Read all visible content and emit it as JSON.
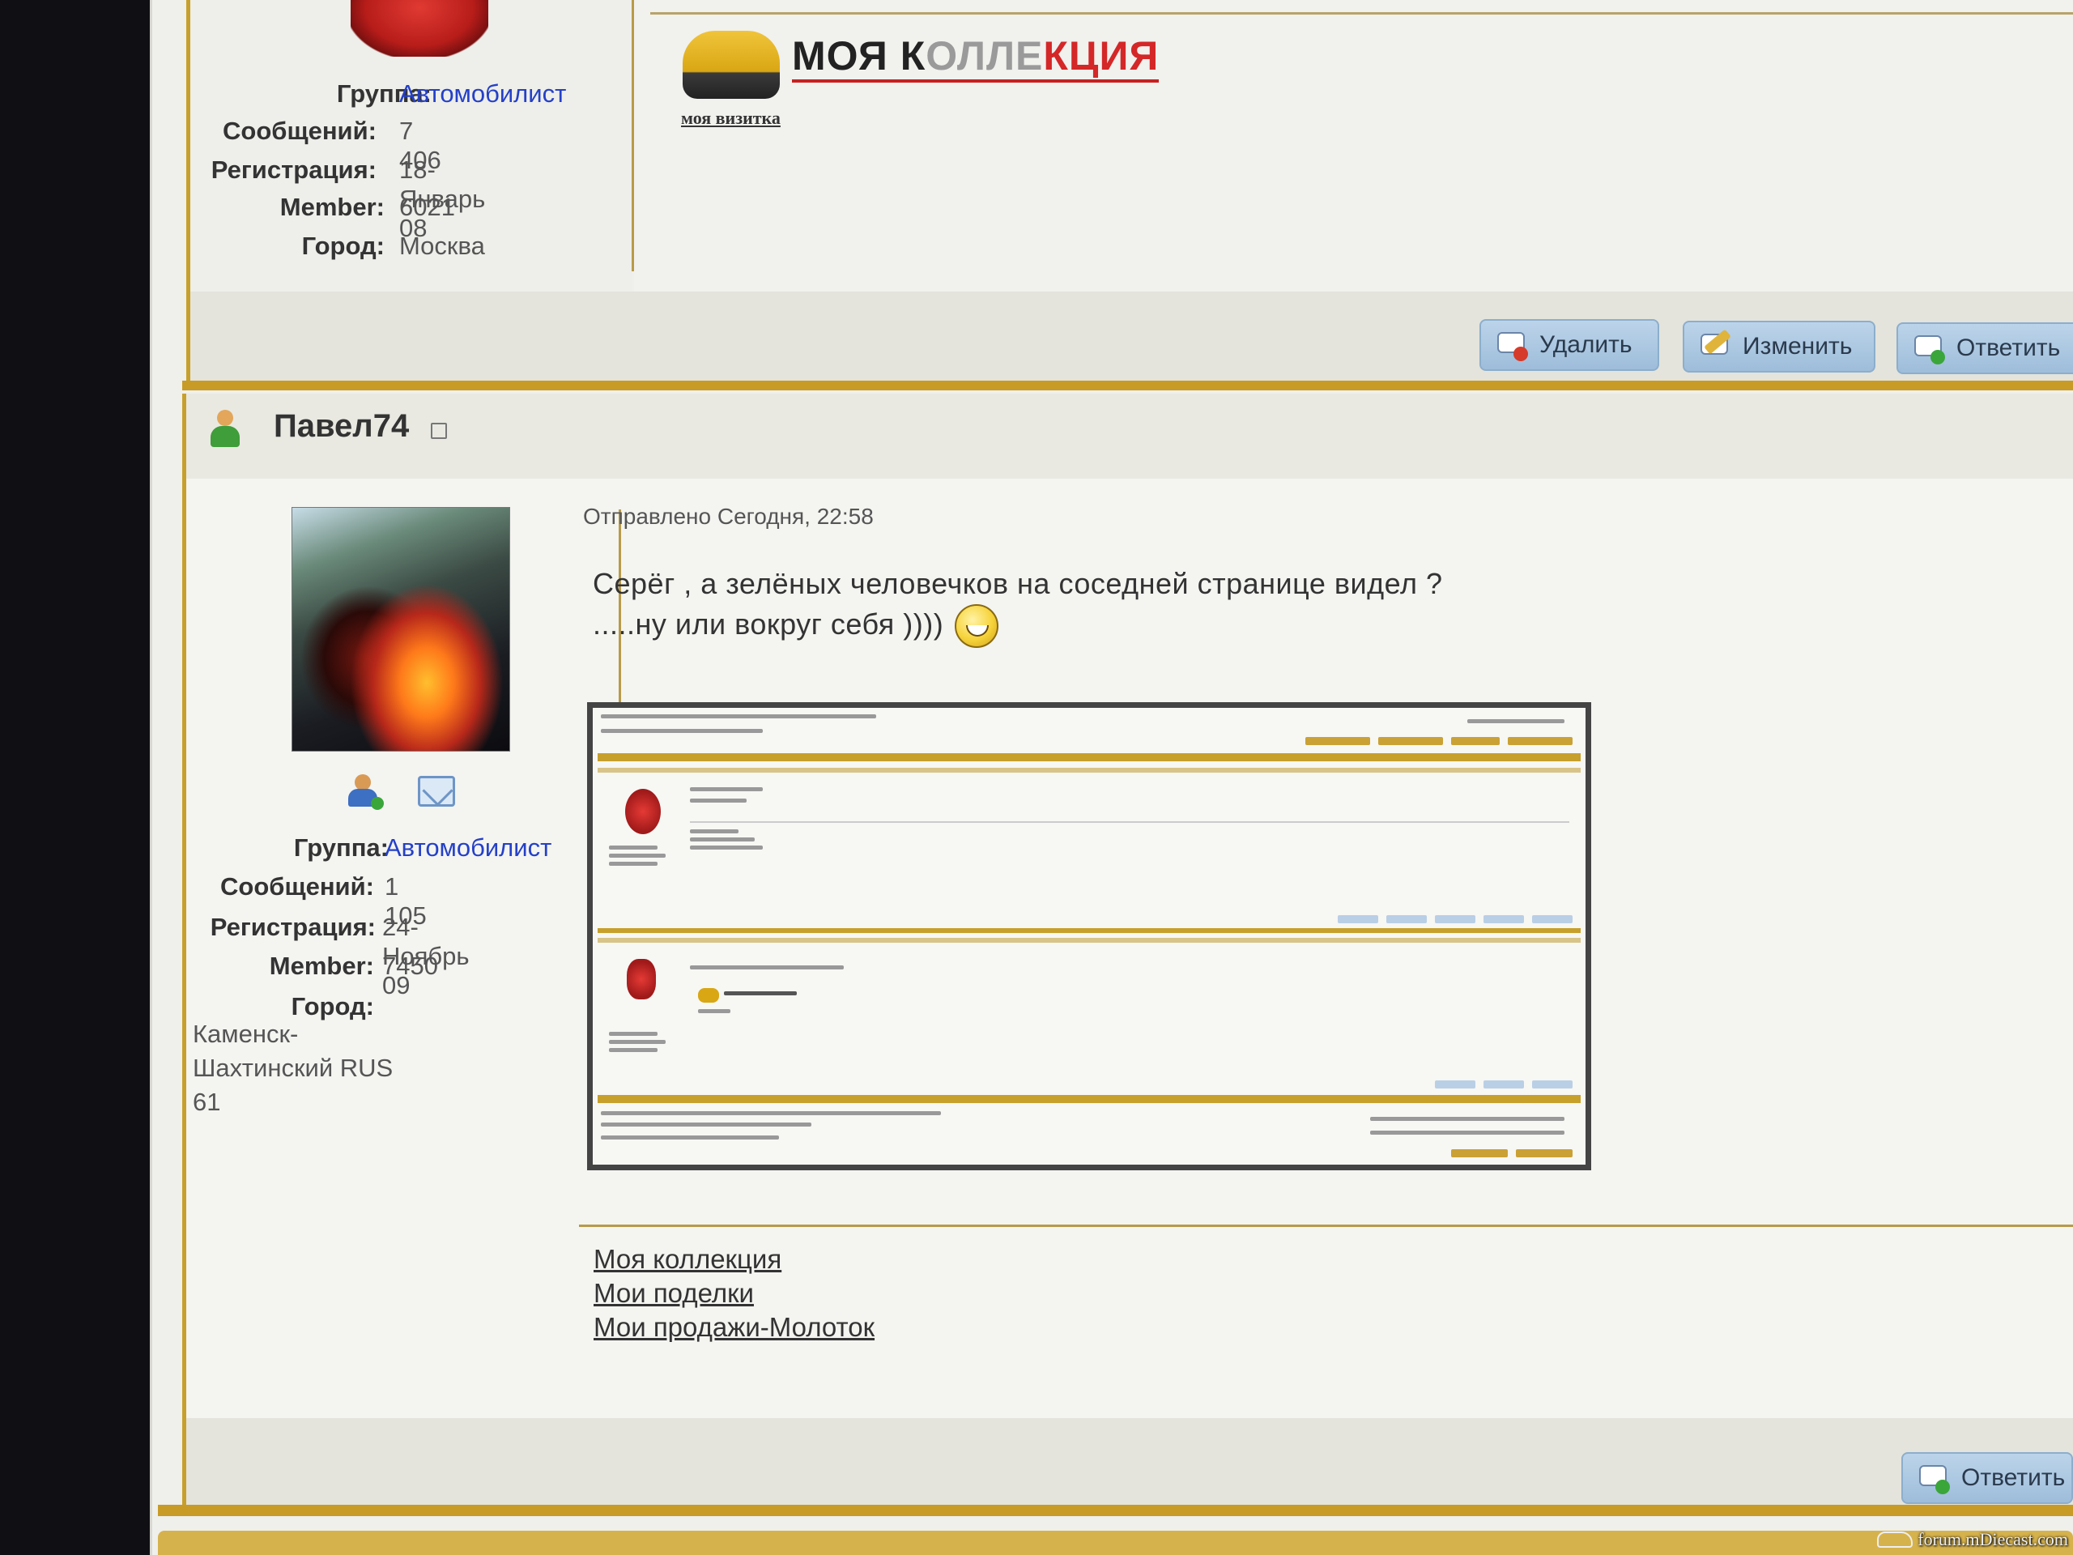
{
  "previous_post": {
    "signature": {
      "title_parts": [
        "МОЯ К",
        "ОЛЛЕ",
        "КЦИЯ"
      ],
      "link": "моя визитка"
    },
    "user_info": {
      "group_label": "Группа:",
      "group_value": "Автомобилист",
      "messages_label": "Сообщений:",
      "messages_value": "7 406",
      "registration_label": "Регистрация:",
      "registration_value": "18-Январь 08",
      "member_label": "Member:",
      "member_value": "6021",
      "city_label": "Город:",
      "city_value": "Москва"
    },
    "actions": {
      "delete": "Удалить",
      "edit": "Изменить",
      "reply": "Ответить"
    }
  },
  "current_post": {
    "username": "Павел74",
    "posted": "Отправлено Сегодня, 22:58",
    "message_line1": "Серёг , а зелёных человечков на соседней странице видел ?",
    "message_line2": ".....ну или вокруг себя ))))",
    "user_info": {
      "group_label": "Группа:",
      "group_value": "Автомобилист",
      "messages_label": "Сообщений:",
      "messages_value": "1 105",
      "registration_label": "Регистрация:",
      "registration_value": "24-Ноябрь 09",
      "member_label": "Member:",
      "member_value": "7450",
      "city_label": "Город:",
      "city_line1": "Каменск-",
      "city_line2": "Шахтинский RUS",
      "city_line3": "61"
    },
    "signature_links": [
      "Моя коллекция",
      "Мои поделки",
      "Мои продажи-Молоток"
    ],
    "actions": {
      "reply": "Ответить"
    }
  },
  "watermark": "forum.mDiecast.com",
  "colors": {
    "accent_gold": "#c79b25",
    "link_blue": "#2440c8",
    "button_blue": "#a9c6e2"
  }
}
